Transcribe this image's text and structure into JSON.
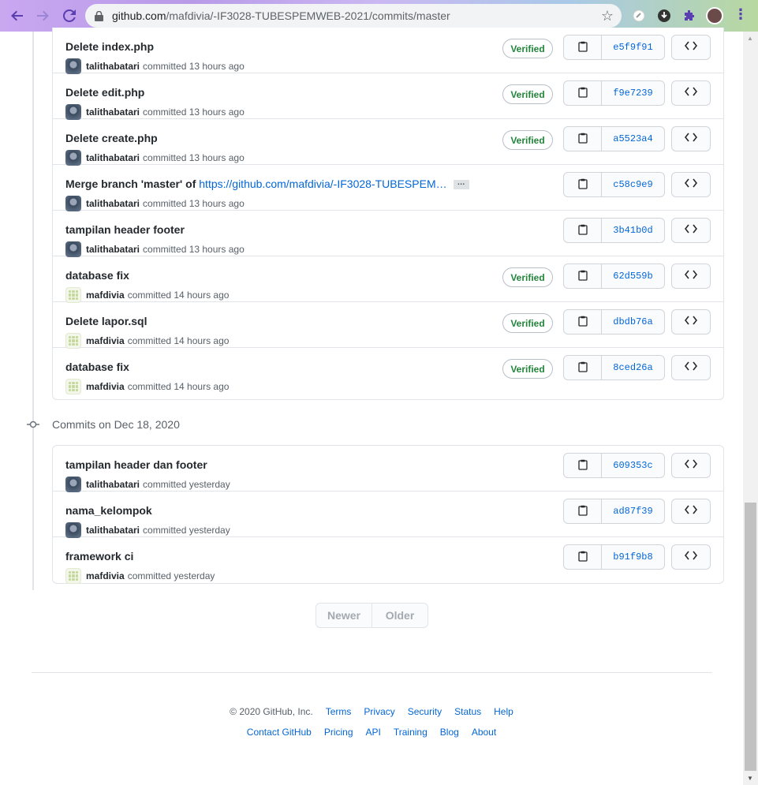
{
  "browser": {
    "url_host": "github.com",
    "url_path": "/mafdivia/-IF3028-TUBESPEMWEB-2021/commits/master"
  },
  "group1": {
    "commits": [
      {
        "title": "Delete index.php",
        "author": "talithabatari",
        "avatar": "t",
        "when": "committed 13 hours ago",
        "verified": true,
        "sha": "e5f9f91"
      },
      {
        "title": "Delete edit.php",
        "author": "talithabatari",
        "avatar": "t",
        "when": "committed 13 hours ago",
        "verified": true,
        "sha": "f9e7239"
      },
      {
        "title": "Delete create.php",
        "author": "talithabatari",
        "avatar": "t",
        "when": "committed 13 hours ago",
        "verified": true,
        "sha": "a5523a4"
      },
      {
        "title": "Merge branch 'master' of ",
        "link": "https://github.com/mafdivia/-IF3028-TUBESPEM…",
        "ellipsis": "…",
        "author": "talithabatari",
        "avatar": "t",
        "when": "committed 13 hours ago",
        "verified": false,
        "sha": "c58c9e9"
      },
      {
        "title": "tampilan header footer",
        "author": "talithabatari",
        "avatar": "t",
        "when": "committed 13 hours ago",
        "verified": false,
        "sha": "3b41b0d"
      },
      {
        "title": "database fix",
        "author": "mafdivia",
        "avatar": "m",
        "when": "committed 14 hours ago",
        "verified": true,
        "sha": "62d559b"
      },
      {
        "title": "Delete lapor.sql",
        "author": "mafdivia",
        "avatar": "m",
        "when": "committed 14 hours ago",
        "verified": true,
        "sha": "dbdb76a"
      },
      {
        "title": "database fix",
        "author": "mafdivia",
        "avatar": "m",
        "when": "committed 14 hours ago",
        "verified": true,
        "sha": "8ced26a"
      }
    ]
  },
  "group2": {
    "header": "Commits on Dec 18, 2020",
    "commits": [
      {
        "title": "tampilan header dan footer",
        "author": "talithabatari",
        "avatar": "t",
        "when": "committed yesterday",
        "verified": false,
        "sha": "609353c"
      },
      {
        "title": "nama_kelompok",
        "author": "talithabatari",
        "avatar": "t",
        "when": "committed yesterday",
        "verified": false,
        "sha": "ad87f39"
      },
      {
        "title": "framework ci",
        "author": "mafdivia",
        "avatar": "m",
        "when": "committed yesterday",
        "verified": false,
        "sha": "b91f9b8"
      }
    ]
  },
  "verified_label": "Verified",
  "pager": {
    "newer": "Newer",
    "older": "Older"
  },
  "footer": {
    "copyright": "© 2020 GitHub, Inc.",
    "links1": [
      "Terms",
      "Privacy",
      "Security",
      "Status",
      "Help"
    ],
    "links2": [
      "Contact GitHub",
      "Pricing",
      "API",
      "Training",
      "Blog",
      "About"
    ]
  },
  "colors": {
    "link": "#0366d6",
    "verified": "#22863a",
    "text": "#24292e",
    "muted": "#586069"
  },
  "icons": [
    "back-arrow-icon",
    "forward-arrow-icon",
    "reload-icon",
    "lock-icon",
    "star-icon",
    "extension-icon",
    "download-icon",
    "puzzle-icon",
    "menu-icon",
    "clipboard-icon",
    "code-icon",
    "commit-node-icon"
  ]
}
